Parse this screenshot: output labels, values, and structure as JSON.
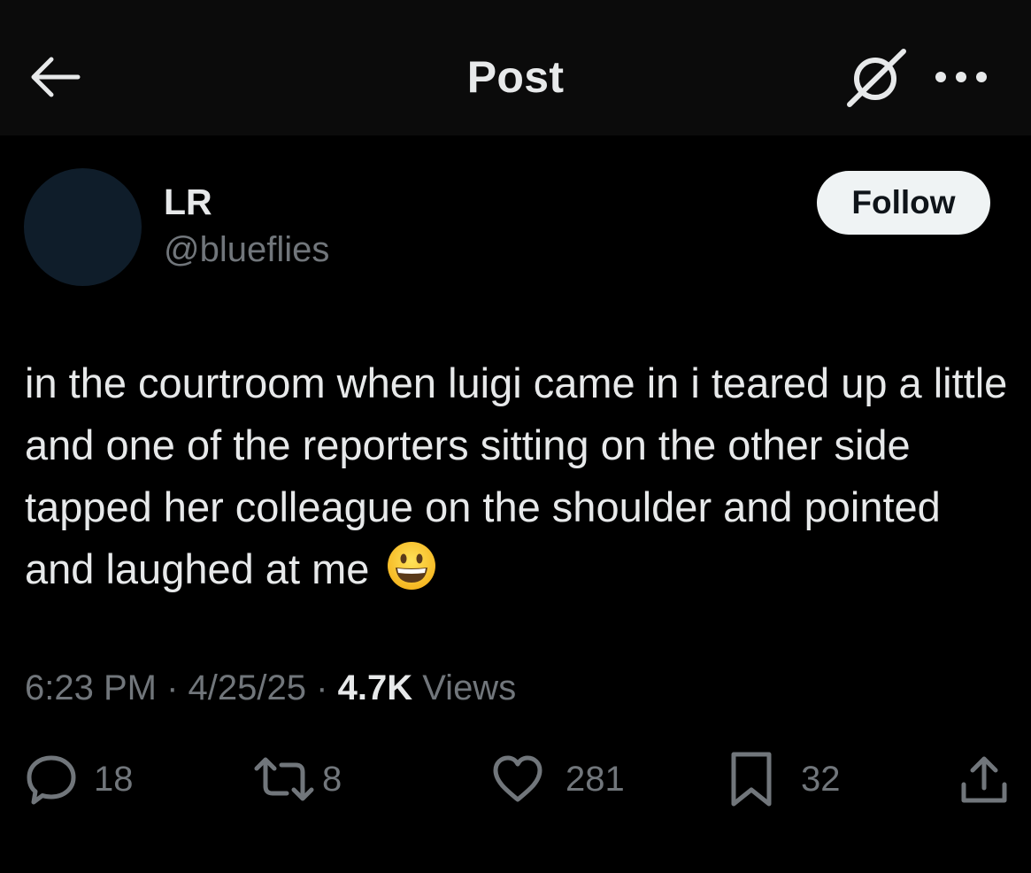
{
  "header": {
    "title": "Post",
    "icons": {
      "back": "arrow-left-icon",
      "grok": "grok-icon",
      "more": "more-icon"
    }
  },
  "author": {
    "display_name": "LR",
    "handle": "@blueflies",
    "avatar_color": "#0f1d2a"
  },
  "follow_label": "Follow",
  "tweet": {
    "text": "in the courtroom when luigi came in i teared up a little and one of the reporters sitting on the other side tapped her colleague on the shoulder and pointed and laughed at me",
    "emoji": "grinning-face-emoji"
  },
  "meta": {
    "time": "6:23 PM",
    "date": "4/25/25",
    "separator": "·",
    "views_count": "4.7K",
    "views_label": "Views"
  },
  "actions": {
    "replies": "18",
    "reposts": "8",
    "likes": "281",
    "bookmarks": "32"
  },
  "colors": {
    "background": "#000000",
    "header_bg": "#0b0b0b",
    "text_primary": "#e7e9ea",
    "text_secondary": "#71767b",
    "follow_bg": "#eff3f4"
  }
}
